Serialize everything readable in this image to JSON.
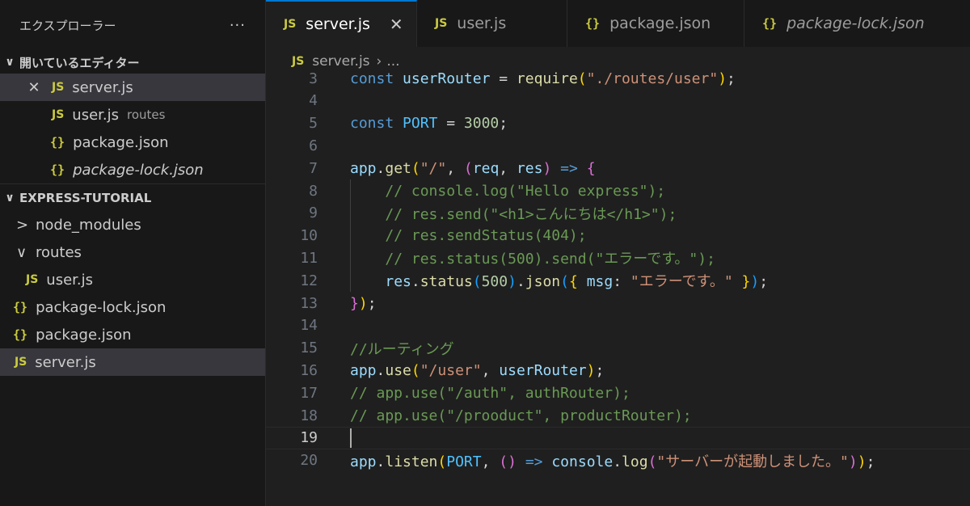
{
  "sidebar": {
    "title": "エクスプローラー",
    "more": "···",
    "open_editors": {
      "title": "開いているエディター",
      "items": [
        {
          "icon": "JS",
          "name": "server.js",
          "hint": ""
        },
        {
          "icon": "JS",
          "name": "user.js",
          "hint": "routes"
        },
        {
          "icon": "{}",
          "name": "package.json",
          "hint": ""
        },
        {
          "icon": "{}",
          "name": "package-lock.json",
          "hint": ""
        }
      ]
    },
    "project": {
      "title": "EXPRESS-TUTORIAL",
      "items": [
        {
          "name": "node_modules"
        },
        {
          "name": "routes"
        },
        {
          "icon": "JS",
          "name": "user.js"
        },
        {
          "icon": "{}",
          "name": "package-lock.json"
        },
        {
          "icon": "{}",
          "name": "package.json"
        },
        {
          "icon": "JS",
          "name": "server.js"
        }
      ]
    }
  },
  "tabs": [
    {
      "icon": "JS",
      "label": "server.js",
      "close": "✕"
    },
    {
      "icon": "JS",
      "label": "user.js"
    },
    {
      "icon": "{}",
      "label": "package.json"
    },
    {
      "icon": "{}",
      "label": "package-lock.json"
    }
  ],
  "breadcrumb": {
    "icon": "JS",
    "file": "server.js",
    "sep": "›",
    "rest": "..."
  },
  "code": {
    "current_line": 19,
    "lines": [
      {
        "n": "3",
        "tokens": [
          [
            "kw",
            "const "
          ],
          [
            "var",
            "userRouter"
          ],
          [
            "pl",
            " = "
          ],
          [
            "fn",
            "require"
          ],
          [
            "p1",
            "("
          ],
          [
            "str",
            "\"./routes/user\""
          ],
          [
            "p1",
            ")"
          ],
          [
            "pl",
            ";"
          ]
        ]
      },
      {
        "n": "4",
        "tokens": []
      },
      {
        "n": "5",
        "tokens": [
          [
            "kw",
            "const "
          ],
          [
            "const",
            "PORT"
          ],
          [
            "pl",
            " = "
          ],
          [
            "num",
            "3000"
          ],
          [
            "pl",
            ";"
          ]
        ]
      },
      {
        "n": "6",
        "tokens": []
      },
      {
        "n": "7",
        "tokens": [
          [
            "var",
            "app"
          ],
          [
            "pl",
            "."
          ],
          [
            "fn",
            "get"
          ],
          [
            "p1",
            "("
          ],
          [
            "str",
            "\"/\""
          ],
          [
            "pl",
            ", "
          ],
          [
            "p2",
            "("
          ],
          [
            "var",
            "req"
          ],
          [
            "pl",
            ", "
          ],
          [
            "var",
            "res"
          ],
          [
            "p2",
            ")"
          ],
          [
            "pl",
            " "
          ],
          [
            "kw",
            "=>"
          ],
          [
            "pl",
            " "
          ],
          [
            "p2",
            "{"
          ]
        ]
      },
      {
        "n": "8",
        "tokens": [
          [
            "pl",
            "    "
          ],
          [
            "com",
            "// console.log(\"Hello express\");"
          ]
        ]
      },
      {
        "n": "9",
        "tokens": [
          [
            "pl",
            "    "
          ],
          [
            "com",
            "// res.send(\"<h1>こんにちは</h1>\");"
          ]
        ]
      },
      {
        "n": "10",
        "tokens": [
          [
            "pl",
            "    "
          ],
          [
            "com",
            "// res.sendStatus(404);"
          ]
        ]
      },
      {
        "n": "11",
        "tokens": [
          [
            "pl",
            "    "
          ],
          [
            "com",
            "// res.status(500).send(\"エラーです。\");"
          ]
        ]
      },
      {
        "n": "12",
        "tokens": [
          [
            "pl",
            "    "
          ],
          [
            "var",
            "res"
          ],
          [
            "pl",
            "."
          ],
          [
            "fn",
            "status"
          ],
          [
            "p3",
            "("
          ],
          [
            "num",
            "500"
          ],
          [
            "p3",
            ")"
          ],
          [
            "pl",
            "."
          ],
          [
            "fn",
            "json"
          ],
          [
            "p3",
            "("
          ],
          [
            "p1",
            "{ "
          ],
          [
            "var",
            "msg"
          ],
          [
            "pl",
            ": "
          ],
          [
            "str",
            "\"エラーです。\""
          ],
          [
            "p1",
            " }"
          ],
          [
            "p3",
            ")"
          ],
          [
            "pl",
            ";"
          ]
        ]
      },
      {
        "n": "13",
        "tokens": [
          [
            "p2",
            "}"
          ],
          [
            "p1",
            ")"
          ],
          [
            "pl",
            ";"
          ]
        ]
      },
      {
        "n": "14",
        "tokens": []
      },
      {
        "n": "15",
        "tokens": [
          [
            "com",
            "//ルーティング"
          ]
        ]
      },
      {
        "n": "16",
        "tokens": [
          [
            "var",
            "app"
          ],
          [
            "pl",
            "."
          ],
          [
            "fn",
            "use"
          ],
          [
            "p1",
            "("
          ],
          [
            "str",
            "\"/user\""
          ],
          [
            "pl",
            ", "
          ],
          [
            "var",
            "userRouter"
          ],
          [
            "p1",
            ")"
          ],
          [
            "pl",
            ";"
          ]
        ]
      },
      {
        "n": "17",
        "tokens": [
          [
            "com",
            "// app.use(\"/auth\", authRouter);"
          ]
        ]
      },
      {
        "n": "18",
        "tokens": [
          [
            "com",
            "// app.use(\"/prooduct\", productRouter);"
          ]
        ]
      },
      {
        "n": "19",
        "tokens": []
      },
      {
        "n": "20",
        "tokens": [
          [
            "var",
            "app"
          ],
          [
            "pl",
            "."
          ],
          [
            "fn",
            "listen"
          ],
          [
            "p1",
            "("
          ],
          [
            "const",
            "PORT"
          ],
          [
            "pl",
            ", "
          ],
          [
            "p2",
            "()"
          ],
          [
            "pl",
            " "
          ],
          [
            "kw",
            "=>"
          ],
          [
            "pl",
            " "
          ],
          [
            "var",
            "console"
          ],
          [
            "pl",
            "."
          ],
          [
            "fn",
            "log"
          ],
          [
            "p2",
            "("
          ],
          [
            "str",
            "\"サーバーが起動しました。\""
          ],
          [
            "p2",
            ")"
          ],
          [
            "p1",
            ")"
          ],
          [
            "pl",
            ";"
          ]
        ]
      }
    ]
  }
}
